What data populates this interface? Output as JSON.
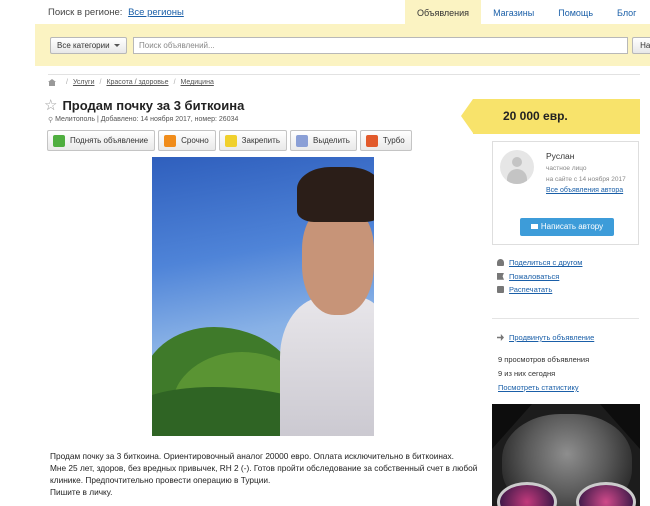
{
  "topbar": {
    "region_label": "Поиск в регионе:",
    "region_link": "Все регионы",
    "tabs": [
      {
        "label": "Объявления",
        "active": true
      },
      {
        "label": "Магазины",
        "active": false
      },
      {
        "label": "Помощь",
        "active": false
      },
      {
        "label": "Блог",
        "active": false
      }
    ]
  },
  "search": {
    "category_label": "Все категории",
    "placeholder": "Поиск объявлений...",
    "value": "",
    "find_label": "Найти"
  },
  "breadcrumb": [
    "Услуги",
    "Красота / здоровье",
    "Медицина"
  ],
  "listing": {
    "title": "Продам почку за 3 биткоина",
    "location": "Мелитополь",
    "added": "Добавлено: 14 ноября 2017, номер: 26034",
    "actions": [
      "Поднять объявление",
      "Срочно",
      "Закрепить",
      "Выделить",
      "Турбо"
    ],
    "description": [
      "Продам почку за 3 биткоина. Ориентировочный аналог 20000 евро. Оплата исключительно в биткоинах.",
      "Мне 25 лет, здоров, без вредных привычек, RH 2 (-). Готов пройти обследование за собственный счет в любой клинике. Предпочтительно провести операцию в Турции.",
      "Пишите в личку."
    ]
  },
  "price": "20 000 евр.",
  "author": {
    "name": "Руслан",
    "type": "частное лицо",
    "since": "на сайте с 14 ноября 2017",
    "all_ads": "Все объявления автора",
    "write_label": "Написать автору"
  },
  "links": {
    "share": "Поделиться с другом",
    "complain": "Пожаловаться",
    "print": "Распечатать",
    "promote": "Продвинуть объявление"
  },
  "stats": {
    "views": "9 просмотров объявления",
    "today": "9 из них сегодня",
    "view_stats": "Посмотреть статистику"
  },
  "colors": {
    "accent_yellow": "#f8e36b",
    "panel_yellow": "#fbf3c2",
    "link_blue": "#1a5fa8",
    "button_blue": "#3d9cd9"
  }
}
